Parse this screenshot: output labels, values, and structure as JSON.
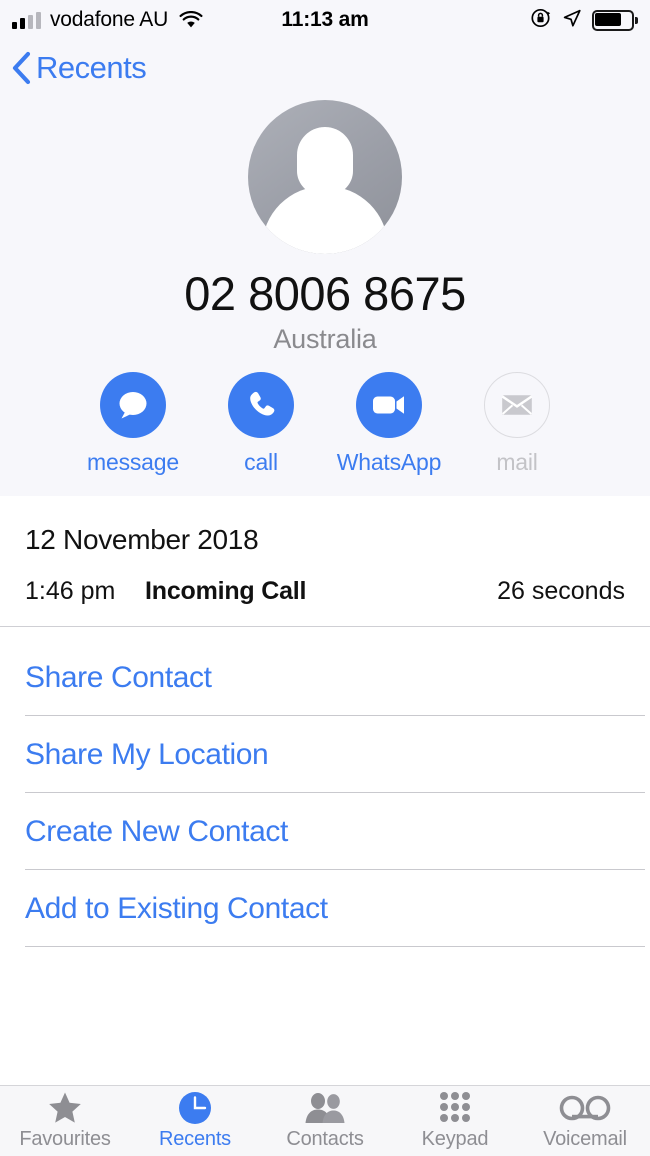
{
  "status_bar": {
    "carrier": "vodafone AU",
    "time": "11:13 am",
    "signal_icon": "signal-bars-icon",
    "wifi_icon": "wifi-icon",
    "rotation_lock_icon": "rotation-lock-icon",
    "location_icon": "location-arrow-icon",
    "battery_icon": "battery-icon",
    "battery_level": 65
  },
  "nav": {
    "back_label": "Recents",
    "back_icon": "chevron-left-icon"
  },
  "contact": {
    "avatar_icon": "person-placeholder-avatar",
    "phone_number": "02 8006 8675",
    "country": "Australia"
  },
  "actions": [
    {
      "label": "message",
      "icon": "message-bubble-icon",
      "enabled": true
    },
    {
      "label": "call",
      "icon": "phone-icon",
      "enabled": true
    },
    {
      "label": "WhatsApp",
      "icon": "video-camera-icon",
      "enabled": true
    },
    {
      "label": "mail",
      "icon": "envelope-icon",
      "enabled": false
    }
  ],
  "call_detail": {
    "date": "12 November 2018",
    "time": "1:46 pm",
    "type": "Incoming Call",
    "duration": "26 seconds"
  },
  "list_actions": [
    {
      "label": "Share Contact"
    },
    {
      "label": "Share My Location"
    },
    {
      "label": "Create New Contact"
    },
    {
      "label": "Add to Existing Contact"
    }
  ],
  "tabs": [
    {
      "label": "Favourites",
      "icon": "star-icon",
      "active": false
    },
    {
      "label": "Recents",
      "icon": "clock-icon",
      "active": true
    },
    {
      "label": "Contacts",
      "icon": "people-icon",
      "active": false
    },
    {
      "label": "Keypad",
      "icon": "keypad-dots-icon",
      "active": false
    },
    {
      "label": "Voicemail",
      "icon": "voicemail-icon",
      "active": false
    }
  ],
  "colors": {
    "accent_blue": "#3c7cf0",
    "header_bg": "#f7f7fb",
    "disabled_gray": "#c3c3c7",
    "tab_inactive": "#8e8e93"
  }
}
